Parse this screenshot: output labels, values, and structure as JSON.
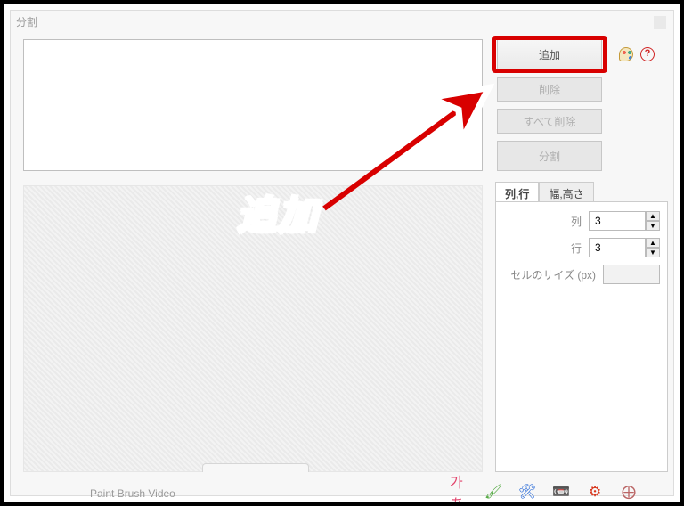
{
  "panel": {
    "title": "分割"
  },
  "buttons": {
    "add": "追加",
    "delete": "削除",
    "delete_all": "すべて削除",
    "split": "分割"
  },
  "tabs": {
    "rowcol": "列,行",
    "wh": "幅,高さ"
  },
  "options": {
    "cols_label": "列",
    "rows_label": "行",
    "cols_value": "3",
    "rows_value": "3",
    "cell_size_label": "セルのサイズ (px)",
    "cell_size_value": ""
  },
  "annotation": {
    "text": "追加"
  },
  "footer": {
    "text": "Paint Brush Video"
  },
  "colors": {
    "highlight": "#d80000"
  }
}
